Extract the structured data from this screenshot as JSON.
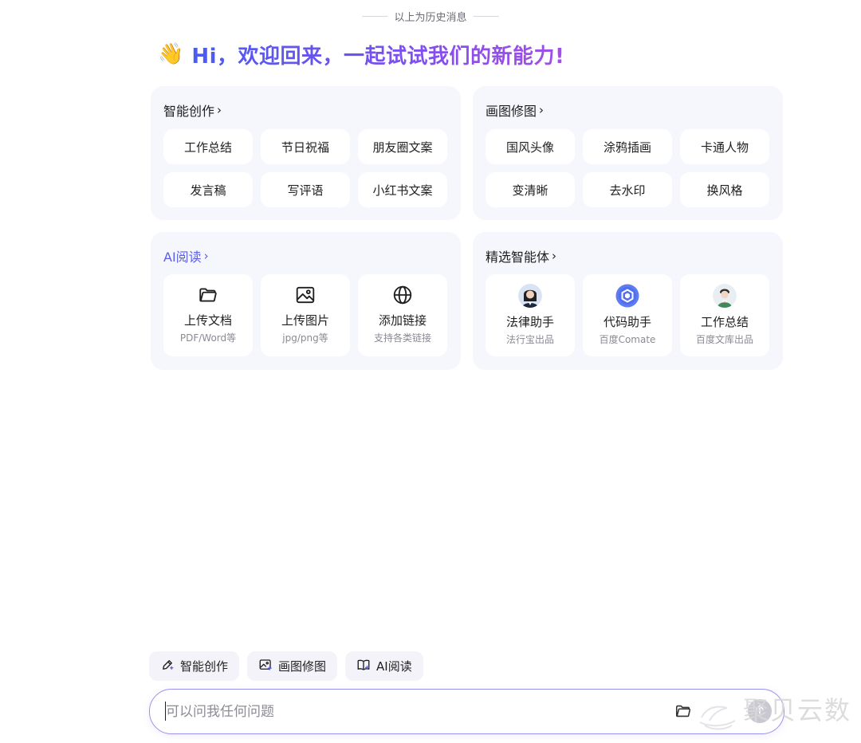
{
  "history_separator": "以上为历史消息",
  "greeting": {
    "emoji": "👋",
    "text": "Hi，欢迎回来，一起试试我们的新能力!"
  },
  "cards": {
    "creation": {
      "title": "智能创作",
      "chips": [
        "工作总结",
        "节日祝福",
        "朋友圈文案",
        "发言稿",
        "写评语",
        "小红书文案"
      ]
    },
    "drawing": {
      "title": "画图修图",
      "chips": [
        "国风头像",
        "涂鸦插画",
        "卡通人物",
        "变清晰",
        "去水印",
        "换风格"
      ]
    },
    "reading": {
      "title": "AI阅读",
      "tiles": [
        {
          "icon": "folder-icon",
          "name": "上传文档",
          "sub": "PDF/Word等"
        },
        {
          "icon": "image-icon",
          "name": "上传图片",
          "sub": "jpg/png等"
        },
        {
          "icon": "globe-icon",
          "name": "添加链接",
          "sub": "支持各类链接"
        }
      ]
    },
    "agents": {
      "title": "精选智能体",
      "tiles": [
        {
          "icon": "lawyer-avatar",
          "name": "法律助手",
          "sub": "法行宝出品"
        },
        {
          "icon": "comate-logo",
          "name": "代码助手",
          "sub": "百度Comate"
        },
        {
          "icon": "worker-avatar",
          "name": "工作总结",
          "sub": "百度文库出品"
        }
      ]
    }
  },
  "quick_actions": [
    "智能创作",
    "画图修图",
    "AI阅读"
  ],
  "input": {
    "placeholder": "可以问我任何问题",
    "value": ""
  },
  "watermark": "聚贝云数",
  "colors": {
    "accent": "#5a5fe6",
    "card_bg": "#f6f6fd",
    "input_border": "#9a92f0"
  }
}
